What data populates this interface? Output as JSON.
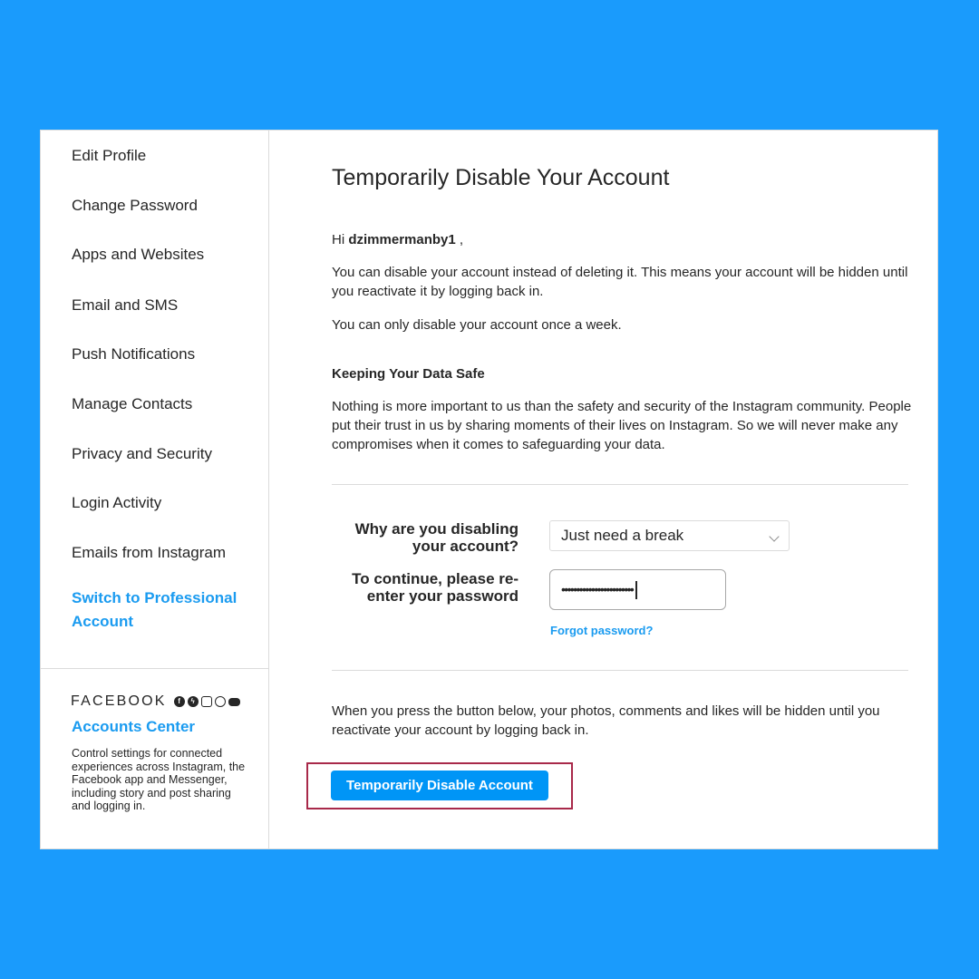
{
  "sidebar": {
    "items": [
      {
        "label": "Edit Profile"
      },
      {
        "label": "Change Password"
      },
      {
        "label": "Apps and Websites"
      },
      {
        "label": "Email and SMS"
      },
      {
        "label": "Push Notifications"
      },
      {
        "label": "Manage Contacts"
      },
      {
        "label": "Privacy and Security"
      },
      {
        "label": "Login Activity"
      },
      {
        "label": "Emails from Instagram"
      },
      {
        "label": "Switch to Professional Account"
      }
    ],
    "facebook": {
      "wordmark": "FACEBOOK",
      "icons": [
        "facebook-icon",
        "messenger-icon",
        "instagram-icon",
        "whatsapp-icon",
        "oculus-icon"
      ],
      "accounts_center": "Accounts Center",
      "description": "Control settings for connected experiences across Instagram, the Facebook app and Messenger, including story and post sharing and logging in."
    }
  },
  "main": {
    "title": "Temporarily Disable Your Account",
    "greeting_prefix": "Hi",
    "username": "dzimmermanby1",
    "greeting_suffix": " ,",
    "intro": "You can disable your account instead of deleting it. This means your account will be hidden until you reactivate it by logging back in.",
    "once_week": "You can only disable your account once a week.",
    "safe_heading": "Keeping Your Data Safe",
    "safe_text": "Nothing is more important to us than the safety and security of the Instagram community. People put their trust in us by sharing moments of their lives on Instagram. So we will never make any compromises when it comes to safeguarding your data.",
    "reason_label": "Why are you disabling your account?",
    "reason_value": "Just need a break",
    "password_label": "To continue, please re-enter your password",
    "password_value": "••••••••••••••••••••••••",
    "forgot_password": "Forgot password?",
    "warning": "When you press the button below, your photos, comments and likes will be hidden until you reactivate your account by logging back in.",
    "disable_button": "Temporarily Disable Account"
  },
  "colors": {
    "background": "#1a9bfc",
    "link": "#1a9bf0",
    "button": "#0095f6",
    "highlight": "#a8294a"
  }
}
